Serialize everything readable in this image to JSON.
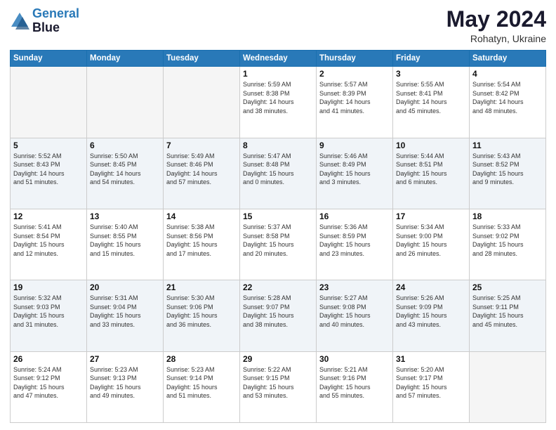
{
  "header": {
    "logo_line1": "General",
    "logo_line2": "Blue",
    "month": "May 2024",
    "location": "Rohatyn, Ukraine"
  },
  "days_of_week": [
    "Sunday",
    "Monday",
    "Tuesday",
    "Wednesday",
    "Thursday",
    "Friday",
    "Saturday"
  ],
  "weeks": [
    [
      {
        "day": "",
        "info": ""
      },
      {
        "day": "",
        "info": ""
      },
      {
        "day": "",
        "info": ""
      },
      {
        "day": "1",
        "info": "Sunrise: 5:59 AM\nSunset: 8:38 PM\nDaylight: 14 hours\nand 38 minutes."
      },
      {
        "day": "2",
        "info": "Sunrise: 5:57 AM\nSunset: 8:39 PM\nDaylight: 14 hours\nand 41 minutes."
      },
      {
        "day": "3",
        "info": "Sunrise: 5:55 AM\nSunset: 8:41 PM\nDaylight: 14 hours\nand 45 minutes."
      },
      {
        "day": "4",
        "info": "Sunrise: 5:54 AM\nSunset: 8:42 PM\nDaylight: 14 hours\nand 48 minutes."
      }
    ],
    [
      {
        "day": "5",
        "info": "Sunrise: 5:52 AM\nSunset: 8:43 PM\nDaylight: 14 hours\nand 51 minutes."
      },
      {
        "day": "6",
        "info": "Sunrise: 5:50 AM\nSunset: 8:45 PM\nDaylight: 14 hours\nand 54 minutes."
      },
      {
        "day": "7",
        "info": "Sunrise: 5:49 AM\nSunset: 8:46 PM\nDaylight: 14 hours\nand 57 minutes."
      },
      {
        "day": "8",
        "info": "Sunrise: 5:47 AM\nSunset: 8:48 PM\nDaylight: 15 hours\nand 0 minutes."
      },
      {
        "day": "9",
        "info": "Sunrise: 5:46 AM\nSunset: 8:49 PM\nDaylight: 15 hours\nand 3 minutes."
      },
      {
        "day": "10",
        "info": "Sunrise: 5:44 AM\nSunset: 8:51 PM\nDaylight: 15 hours\nand 6 minutes."
      },
      {
        "day": "11",
        "info": "Sunrise: 5:43 AM\nSunset: 8:52 PM\nDaylight: 15 hours\nand 9 minutes."
      }
    ],
    [
      {
        "day": "12",
        "info": "Sunrise: 5:41 AM\nSunset: 8:54 PM\nDaylight: 15 hours\nand 12 minutes."
      },
      {
        "day": "13",
        "info": "Sunrise: 5:40 AM\nSunset: 8:55 PM\nDaylight: 15 hours\nand 15 minutes."
      },
      {
        "day": "14",
        "info": "Sunrise: 5:38 AM\nSunset: 8:56 PM\nDaylight: 15 hours\nand 17 minutes."
      },
      {
        "day": "15",
        "info": "Sunrise: 5:37 AM\nSunset: 8:58 PM\nDaylight: 15 hours\nand 20 minutes."
      },
      {
        "day": "16",
        "info": "Sunrise: 5:36 AM\nSunset: 8:59 PM\nDaylight: 15 hours\nand 23 minutes."
      },
      {
        "day": "17",
        "info": "Sunrise: 5:34 AM\nSunset: 9:00 PM\nDaylight: 15 hours\nand 26 minutes."
      },
      {
        "day": "18",
        "info": "Sunrise: 5:33 AM\nSunset: 9:02 PM\nDaylight: 15 hours\nand 28 minutes."
      }
    ],
    [
      {
        "day": "19",
        "info": "Sunrise: 5:32 AM\nSunset: 9:03 PM\nDaylight: 15 hours\nand 31 minutes."
      },
      {
        "day": "20",
        "info": "Sunrise: 5:31 AM\nSunset: 9:04 PM\nDaylight: 15 hours\nand 33 minutes."
      },
      {
        "day": "21",
        "info": "Sunrise: 5:30 AM\nSunset: 9:06 PM\nDaylight: 15 hours\nand 36 minutes."
      },
      {
        "day": "22",
        "info": "Sunrise: 5:28 AM\nSunset: 9:07 PM\nDaylight: 15 hours\nand 38 minutes."
      },
      {
        "day": "23",
        "info": "Sunrise: 5:27 AM\nSunset: 9:08 PM\nDaylight: 15 hours\nand 40 minutes."
      },
      {
        "day": "24",
        "info": "Sunrise: 5:26 AM\nSunset: 9:09 PM\nDaylight: 15 hours\nand 43 minutes."
      },
      {
        "day": "25",
        "info": "Sunrise: 5:25 AM\nSunset: 9:11 PM\nDaylight: 15 hours\nand 45 minutes."
      }
    ],
    [
      {
        "day": "26",
        "info": "Sunrise: 5:24 AM\nSunset: 9:12 PM\nDaylight: 15 hours\nand 47 minutes."
      },
      {
        "day": "27",
        "info": "Sunrise: 5:23 AM\nSunset: 9:13 PM\nDaylight: 15 hours\nand 49 minutes."
      },
      {
        "day": "28",
        "info": "Sunrise: 5:23 AM\nSunset: 9:14 PM\nDaylight: 15 hours\nand 51 minutes."
      },
      {
        "day": "29",
        "info": "Sunrise: 5:22 AM\nSunset: 9:15 PM\nDaylight: 15 hours\nand 53 minutes."
      },
      {
        "day": "30",
        "info": "Sunrise: 5:21 AM\nSunset: 9:16 PM\nDaylight: 15 hours\nand 55 minutes."
      },
      {
        "day": "31",
        "info": "Sunrise: 5:20 AM\nSunset: 9:17 PM\nDaylight: 15 hours\nand 57 minutes."
      },
      {
        "day": "",
        "info": ""
      }
    ]
  ]
}
